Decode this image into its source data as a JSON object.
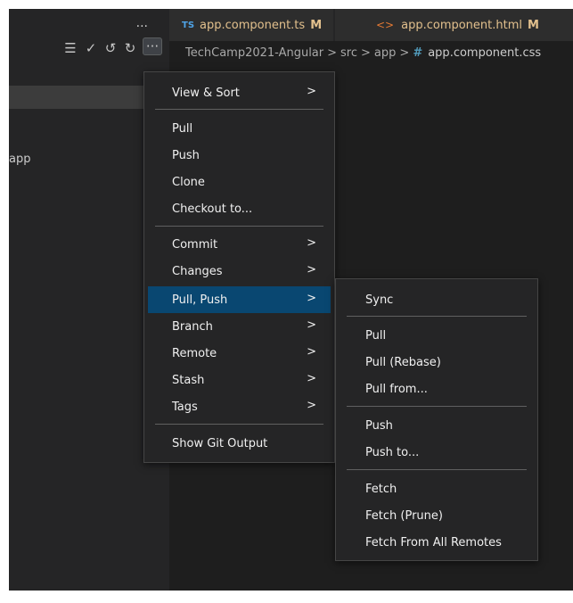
{
  "sidebar": {
    "ellipsis": "···",
    "repo_label": "app",
    "toolbar_icons": [
      "tree-view-icon",
      "check-icon",
      "history-icon",
      "refresh-icon",
      "more-actions-icon"
    ],
    "toolbar_glyphs": {
      "tree": "☰",
      "check": "✓",
      "history": "↺",
      "refresh": "↻",
      "more": "···"
    }
  },
  "tabs": [
    {
      "glyph": "TS",
      "name": "app.component.ts",
      "status": "M"
    },
    {
      "glyph": "<>",
      "name": "app.component.html",
      "status": "M"
    }
  ],
  "breadcrumbs": {
    "items": [
      "TechCamp2021-Angular",
      "src",
      "app"
    ],
    "file_glyph": "#",
    "file": "app.component.css",
    "separator": ">"
  },
  "menu": {
    "items": [
      {
        "label": "View & Sort",
        "submenu": true
      },
      {
        "label": "Pull",
        "submenu": false
      },
      {
        "label": "Push",
        "submenu": false
      },
      {
        "label": "Clone",
        "submenu": false
      },
      {
        "label": "Checkout to...",
        "submenu": false
      },
      {
        "label": "Commit",
        "submenu": true
      },
      {
        "label": "Changes",
        "submenu": true
      },
      {
        "label": "Pull, Push",
        "submenu": true,
        "active": true
      },
      {
        "label": "Branch",
        "submenu": true
      },
      {
        "label": "Remote",
        "submenu": true
      },
      {
        "label": "Stash",
        "submenu": true
      },
      {
        "label": "Tags",
        "submenu": true
      },
      {
        "label": "Show Git Output",
        "submenu": false
      }
    ],
    "chevron": ">"
  },
  "submenu": {
    "items": [
      {
        "label": "Sync"
      },
      {
        "label": "Pull"
      },
      {
        "label": "Pull (Rebase)"
      },
      {
        "label": "Pull from..."
      },
      {
        "label": "Push"
      },
      {
        "label": "Push to..."
      },
      {
        "label": "Fetch"
      },
      {
        "label": "Fetch (Prune)"
      },
      {
        "label": "Fetch From All Remotes"
      }
    ]
  },
  "colors": {
    "active_item": "#094771",
    "modified": "#e2c08d",
    "ts_icon": "#4fa3e6",
    "html_icon": "#e37933",
    "css_icon": "#519aba"
  }
}
